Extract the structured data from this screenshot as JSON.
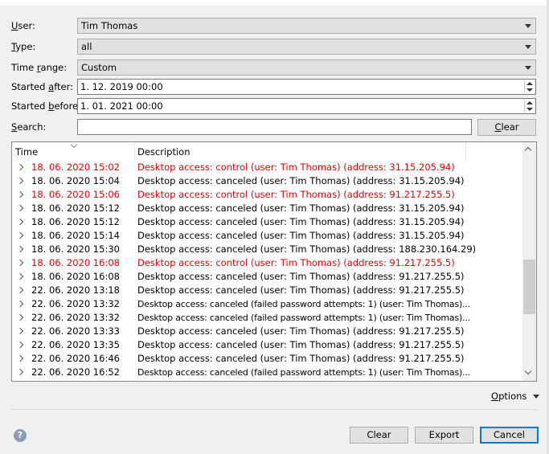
{
  "filters": {
    "user": {
      "label_pre": "",
      "label_ul": "U",
      "label_post": "ser:",
      "value": "Tim Thomas"
    },
    "type": {
      "label_pre": "",
      "label_ul": "T",
      "label_post": "ype:",
      "value": "all"
    },
    "time_range": {
      "label_pre": "Time ",
      "label_ul": "r",
      "label_post": "ange:",
      "value": "Custom"
    },
    "started_after": {
      "label_pre": "Started ",
      "label_ul": "a",
      "label_post": "fter:",
      "value": "1. 12. 2019 00:00"
    },
    "started_before": {
      "label_pre": "Started ",
      "label_ul": "b",
      "label_post": "efore:",
      "value": "1. 01. 2021 00:00"
    },
    "search": {
      "label_pre": "",
      "label_ul": "S",
      "label_post": "earch:",
      "value": "",
      "placeholder": ""
    },
    "clear_button": {
      "label_pre": "",
      "label_ul": "C",
      "label_post": "lear"
    }
  },
  "table": {
    "columns": [
      "Time",
      "Description"
    ],
    "rows": [
      {
        "time": "18. 06. 2020 15:02",
        "description": "Desktop access: control (user: Tim Thomas) (address: 31.15.205.94)",
        "highlight": true
      },
      {
        "time": "18. 06. 2020 15:04",
        "description": "Desktop access: canceled (user: Tim Thomas) (address: 31.15.205.94)",
        "highlight": false
      },
      {
        "time": "18. 06. 2020 15:06",
        "description": "Desktop access: control (user: Tim Thomas) (address: 91.217.255.5)",
        "highlight": true
      },
      {
        "time": "18. 06. 2020 15:12",
        "description": "Desktop access: canceled (user: Tim Thomas) (address: 31.15.205.94)",
        "highlight": false
      },
      {
        "time": "18. 06. 2020 15:12",
        "description": "Desktop access: canceled (user: Tim Thomas) (address: 31.15.205.94)",
        "highlight": false
      },
      {
        "time": "18. 06. 2020 15:14",
        "description": "Desktop access: canceled (user: Tim Thomas) (address: 31.15.205.94)",
        "highlight": false
      },
      {
        "time": "18. 06. 2020 15:30",
        "description": "Desktop access: canceled (user: Tim Thomas) (address: 188.230.164.29)",
        "highlight": false
      },
      {
        "time": "18. 06. 2020 16:08",
        "description": "Desktop access: control (user: Tim Thomas) (address: 91.217.255.5)",
        "highlight": true
      },
      {
        "time": "18. 06. 2020 16:08",
        "description": "Desktop access: canceled (user: Tim Thomas) (address: 91.217.255.5)",
        "highlight": false
      },
      {
        "time": "22. 06. 2020 13:18",
        "description": "Desktop access: canceled (user: Tim Thomas) (address: 91.217.255.5)",
        "highlight": false
      },
      {
        "time": "22. 06. 2020 13:32",
        "description": "Desktop access: canceled (failed password attempts: 1) (user: Tim Thomas)...",
        "highlight": false,
        "small": true
      },
      {
        "time": "22. 06. 2020 13:32",
        "description": "Desktop access: canceled (failed password attempts: 1) (user: Tim Thomas)...",
        "highlight": false,
        "small": true
      },
      {
        "time": "22. 06. 2020 13:33",
        "description": "Desktop access: canceled (user: Tim Thomas) (address: 91.217.255.5)",
        "highlight": false
      },
      {
        "time": "22. 06. 2020 13:35",
        "description": "Desktop access: canceled (user: Tim Thomas) (address: 91.217.255.5)",
        "highlight": false
      },
      {
        "time": "22. 06. 2020 16:46",
        "description": "Desktop access: canceled (user: Tim Thomas) (address: 91.217.255.5)",
        "highlight": false
      },
      {
        "time": "22. 06. 2020 16:52",
        "description": "Desktop access: canceled (failed password attempts: 1) (user: Tim Thomas)...",
        "highlight": false,
        "small": true
      }
    ]
  },
  "options": {
    "label_pre": "",
    "label_ul": "O",
    "label_post": "ptions"
  },
  "footer": {
    "help_icon": "question-circle-icon",
    "clear_label": "Clear",
    "export_label": "Export",
    "cancel_label": "Cancel"
  },
  "colors": {
    "highlight": "#e00000",
    "accent": "#0078d7"
  }
}
